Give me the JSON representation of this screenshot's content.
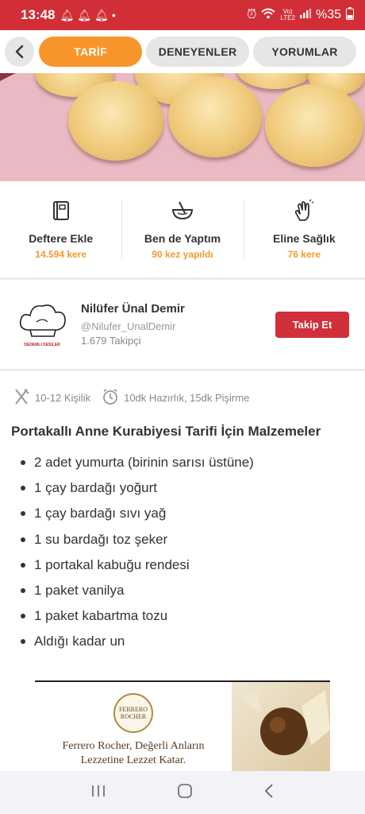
{
  "status_bar": {
    "time": "13:48",
    "network_top": "Vo)",
    "network_bottom": "LTE2",
    "battery": "%35"
  },
  "tabs": [
    {
      "label": "TARİF",
      "active": true
    },
    {
      "label": "DENEYENLER",
      "active": false
    },
    {
      "label": "YORUMLAR",
      "active": false
    }
  ],
  "actions": [
    {
      "icon": "notebook-icon",
      "label": "Deftere Ekle",
      "count": "14.594 kere"
    },
    {
      "icon": "mixing-bowl-icon",
      "label": "Ben de Yaptım",
      "count": "90 kez yapıldı"
    },
    {
      "icon": "clapping-hands-icon",
      "label": "Eline Sağlık",
      "count": "76 kere"
    }
  ],
  "author": {
    "logo_text": "DEDEMLI DESILER",
    "name": "Nilüfer Ünal Demir",
    "handle": "@Nilufer_UnalDemir",
    "followers": "1.679 Takipçi",
    "follow_label": "Takip Et"
  },
  "meta": {
    "servings": "10-12 Kişilik",
    "time": "10dk Hazırlık, 15dk Pişirme"
  },
  "ingredients_title": "Portakallı Anne Kurabiyesi Tarifi İçin Malzemeler",
  "ingredients": [
    "2 adet yumurta (birinin sarısı üstüne)",
    "1 çay bardağı yoğurt",
    "1 çay bardağı sıvı yağ",
    "1 su bardağı toz şeker",
    "1 portakal kabuğu rendesi",
    "1 paket vanilya",
    "1 paket kabartma tozu",
    "Aldığı kadar un"
  ],
  "ad": {
    "brand_line1": "FERRERO",
    "brand_line2": "ROCHER",
    "text_line1": "Ferrero Rocher, Değerli Anların",
    "text_line2": "Lezzetine Lezzet Katar."
  },
  "colors": {
    "status_bar": "#d12e37",
    "accent_orange": "#f7952b",
    "follow_button": "#d0303a",
    "count_text": "#f39a2d"
  }
}
